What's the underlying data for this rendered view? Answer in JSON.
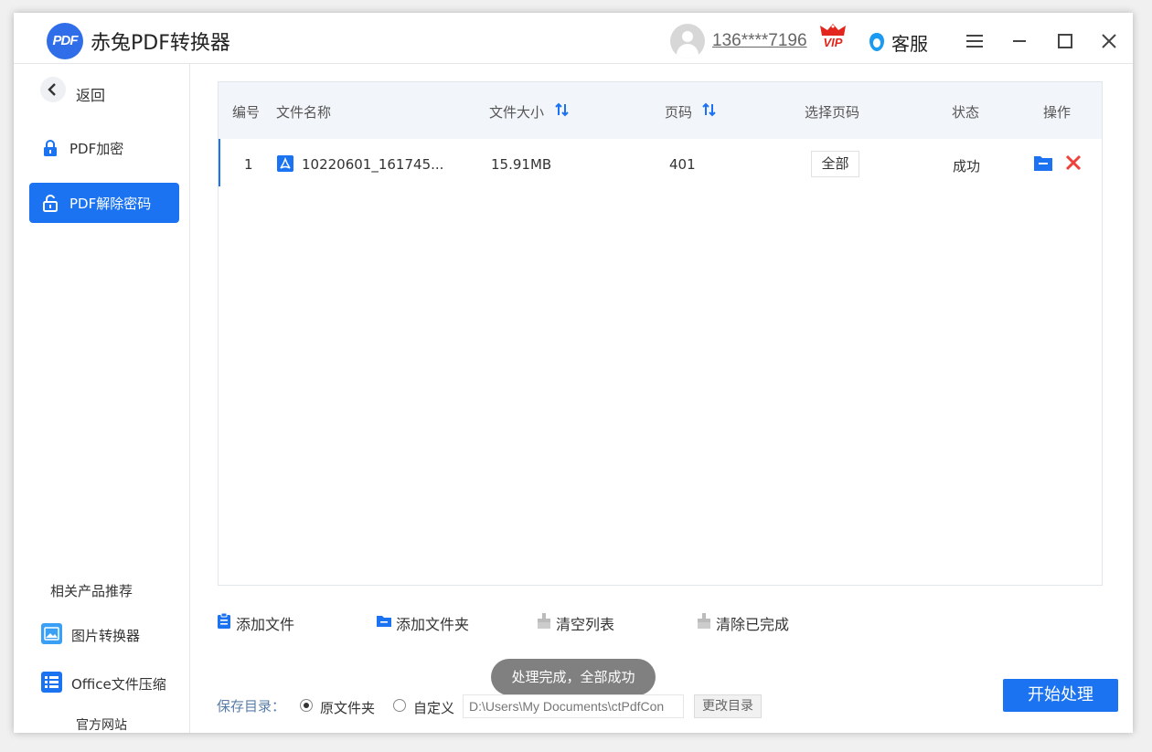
{
  "app": {
    "logo_text": "PDF",
    "title": "赤兔PDF转换器",
    "user_id": "136****7196",
    "vip_label": "VIP",
    "support_label": "客服"
  },
  "sidebar": {
    "back_label": "返回",
    "items": [
      {
        "label": "PDF加密",
        "icon": "lock-icon",
        "active": false
      },
      {
        "label": "PDF解除密码",
        "icon": "unlock-icon",
        "active": true
      }
    ],
    "related_title": "相关产品推荐",
    "products": [
      {
        "label": "图片转换器",
        "icon": "image-icon"
      },
      {
        "label": "Office文件压缩",
        "icon": "list-icon"
      }
    ],
    "official_site": "官方网站"
  },
  "table": {
    "headers": {
      "index": "编号",
      "name": "文件名称",
      "size": "文件大小",
      "pages": "页码",
      "select_pages": "选择页码",
      "status": "状态",
      "actions": "操作"
    },
    "rows": [
      {
        "index": "1",
        "name": "10220601_161745...",
        "size": "15.91MB",
        "pages": "401",
        "select_pages": "全部",
        "status": "成功"
      }
    ]
  },
  "toolbar": {
    "add_file": "添加文件",
    "add_folder": "添加文件夹",
    "clear_list": "清空列表",
    "clear_done": "清除已完成"
  },
  "toast": "处理完成，全部成功",
  "save": {
    "label": "保存目录：",
    "option_original": "原文件夹",
    "option_custom": "自定义",
    "selected": "原文件夹",
    "path": "D:\\Users\\My Documents\\ctPdfCon",
    "change_dir": "更改目录"
  },
  "start_button": "开始处理",
  "colors": {
    "accent": "#1b73f2",
    "vip_red": "#e3261d",
    "toast_bg": "#808080"
  }
}
